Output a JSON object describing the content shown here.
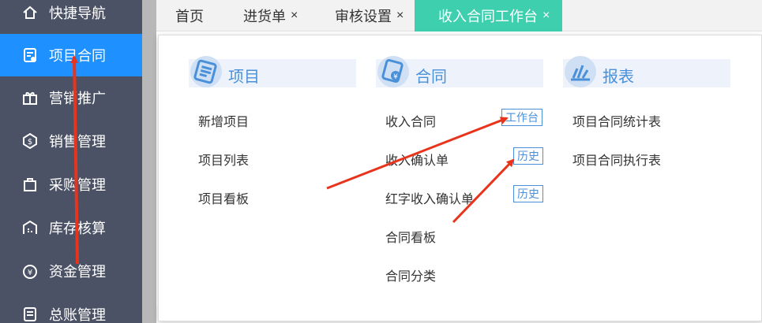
{
  "sidebar": {
    "items": [
      {
        "label": "快捷导航",
        "icon": "home-icon"
      },
      {
        "label": "项目合同",
        "icon": "contract-icon",
        "active": true
      },
      {
        "label": "营销推广",
        "icon": "gift-icon"
      },
      {
        "label": "销售管理",
        "icon": "sales-icon"
      },
      {
        "label": "采购管理",
        "icon": "bag-icon"
      },
      {
        "label": "库存核算",
        "icon": "warehouse-icon"
      },
      {
        "label": "资金管理",
        "icon": "money-icon"
      },
      {
        "label": "总账管理",
        "icon": "ledger-icon"
      }
    ]
  },
  "tabs": [
    {
      "label": "首页",
      "closable": false
    },
    {
      "label": "进货单",
      "closable": true
    },
    {
      "label": "审核设置",
      "closable": true
    },
    {
      "label": "收入合同工作台",
      "closable": true,
      "active": true
    }
  ],
  "tab_close_glyph": "×",
  "menu": {
    "columns": [
      {
        "title": "项目",
        "icon": "list-icon",
        "items": [
          "新增项目",
          "项目列表",
          "项目看板"
        ]
      },
      {
        "title": "合同",
        "icon": "contract-seal-icon",
        "items": [
          "收入合同",
          "收入确认单",
          "红字收入确认单",
          "合同看板",
          "合同分类"
        ]
      },
      {
        "title": "报表",
        "icon": "report-icon",
        "items": [
          "项目合同统计表",
          "项目合同执行表"
        ]
      }
    ],
    "badges": {
      "workbench": "工作台",
      "history1": "历史",
      "history2": "历史"
    }
  },
  "colors": {
    "sidebar_bg": "#4c5266",
    "sidebar_active": "#1e90ff",
    "tab_active": "#3ecfae",
    "accent_blue": "#4a90d9",
    "arrow_red": "#e8341c"
  }
}
